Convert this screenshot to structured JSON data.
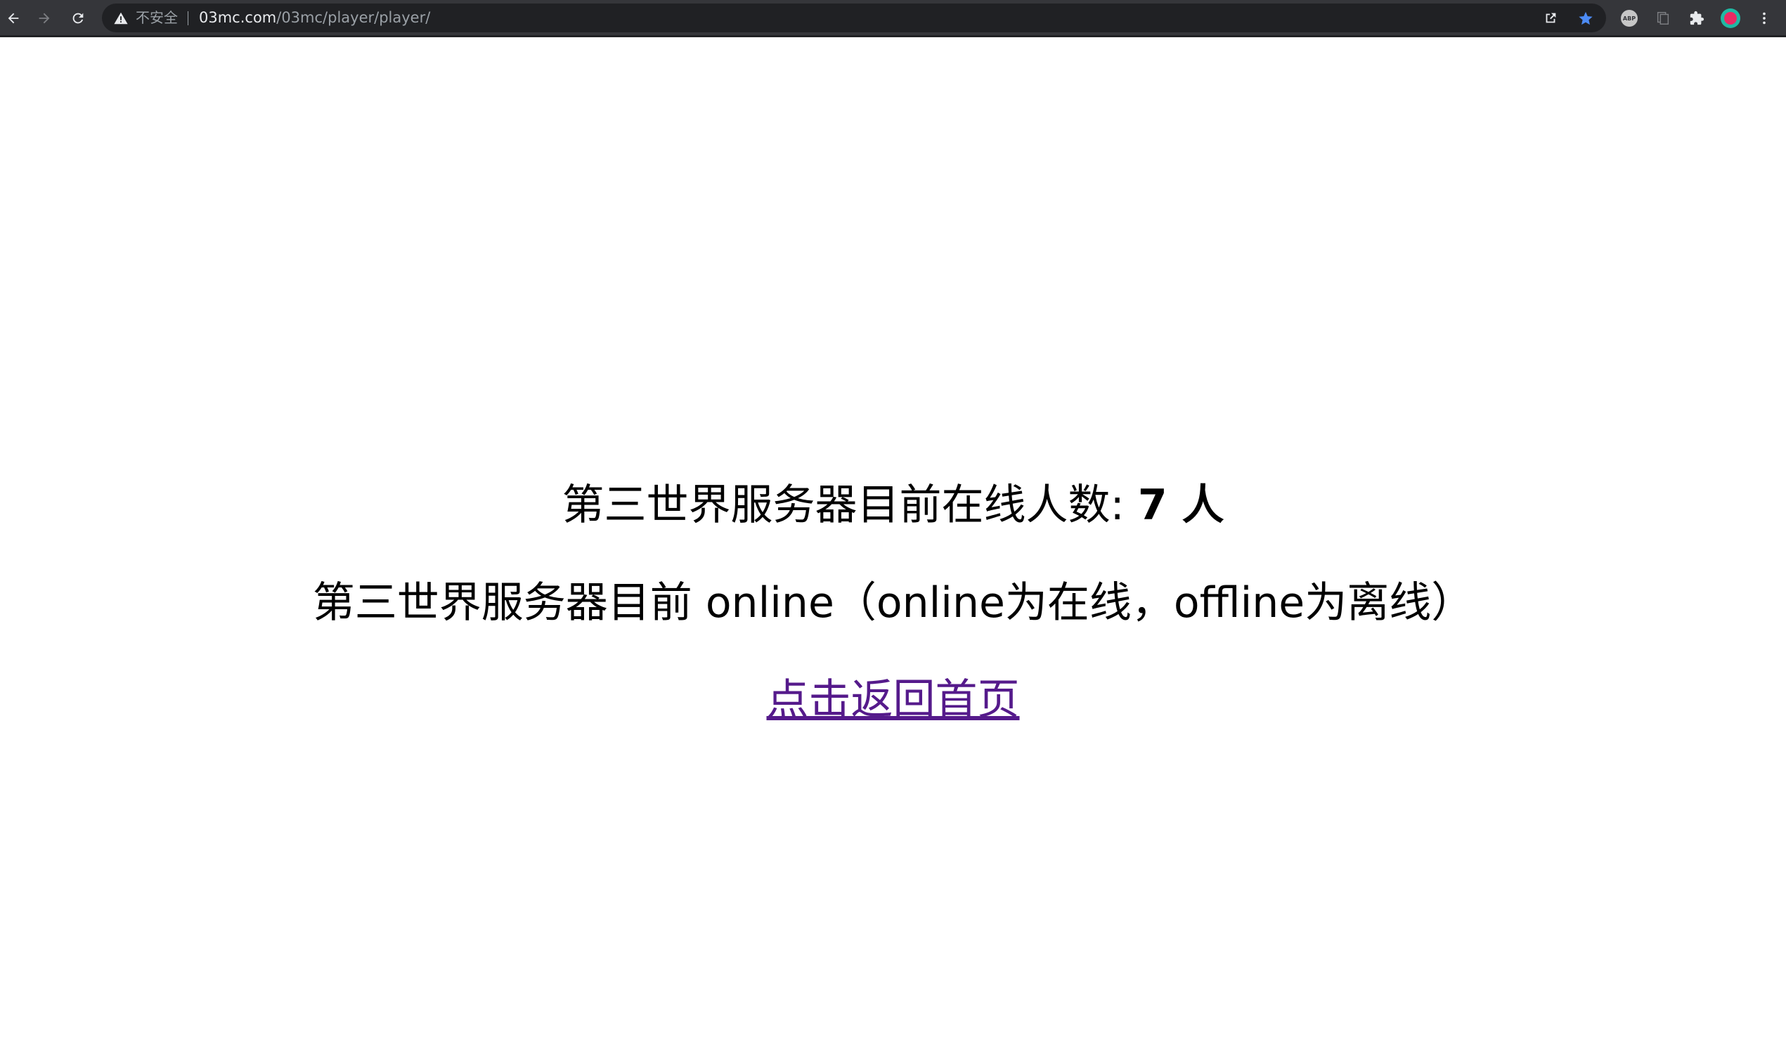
{
  "browser": {
    "security_label": "不安全",
    "url_host": "03mc.com",
    "url_path": "/03mc/player/player/",
    "icons": [
      "back-icon",
      "forward-icon",
      "reload-icon",
      "warning-icon",
      "share-icon",
      "bookmark-star-icon",
      "adblock-icon",
      "reading-list-icon",
      "extensions-icon",
      "profile-icon",
      "menu-icon"
    ],
    "bookmark_color": "#4c8bf5"
  },
  "page": {
    "online_label": "第三世界服务器目前在线人数: ",
    "online_count": "7",
    "online_unit": " 人",
    "status_prefix": "第三世界服务器目前 ",
    "status_value": "online",
    "status_note": "（online为在线，offline为离线）",
    "home_link": "点击返回首页"
  },
  "colors": {
    "toolbar": "#35363a",
    "omnibox": "#202124",
    "link_visited": "#551a8b",
    "text": "#000000"
  }
}
